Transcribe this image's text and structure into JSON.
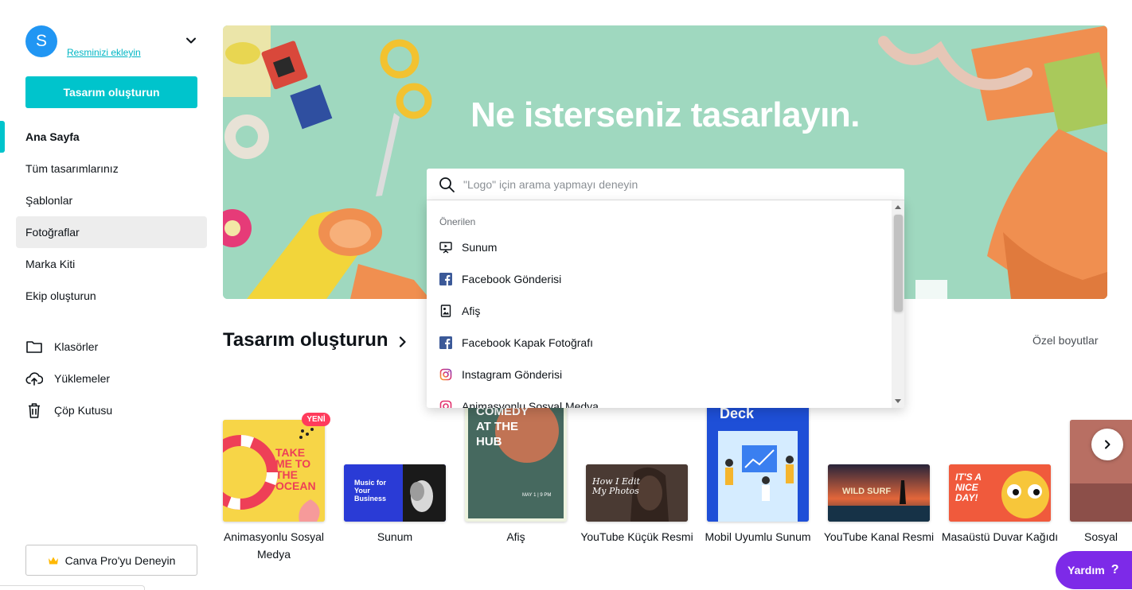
{
  "account": {
    "avatar_initial": "S",
    "add_photo_link": "Resminizi ekleyin"
  },
  "sidebar": {
    "create_button": "Tasarım oluşturun",
    "nav": [
      {
        "label": "Ana Sayfa"
      },
      {
        "label": "Tüm tasarımlarınız"
      },
      {
        "label": "Şablonlar"
      },
      {
        "label": "Fotoğraflar"
      },
      {
        "label": "Marka Kiti"
      },
      {
        "label": "Ekip oluşturun"
      }
    ],
    "secondary": [
      {
        "label": "Klasörler",
        "icon": "folder-icon"
      },
      {
        "label": "Yüklemeler",
        "icon": "cloud-upload-icon"
      },
      {
        "label": "Çöp Kutusu",
        "icon": "trash-icon"
      }
    ],
    "pro_button": "Canva Pro'yu Deneyin"
  },
  "hero": {
    "title": "Ne isterseniz tasarlayın."
  },
  "search": {
    "placeholder": "\"Logo\" için arama yapmayı deneyin",
    "dropdown_heading": "Önerilen",
    "suggestions": [
      {
        "label": "Sunum",
        "icon": "presentation-icon"
      },
      {
        "label": "Facebook Gönderisi",
        "icon": "facebook-icon"
      },
      {
        "label": "Afiş",
        "icon": "poster-icon"
      },
      {
        "label": "Facebook Kapak Fotoğrafı",
        "icon": "facebook-icon"
      },
      {
        "label": "Instagram Gönderisi",
        "icon": "instagram-icon"
      },
      {
        "label": "Animasyonlu Sosyal Medya",
        "icon": "instagram-icon"
      }
    ]
  },
  "create_section": {
    "title": "Tasarım oluşturun",
    "custom_size": "Özel boyutlar",
    "new_badge": "YENİ",
    "cards": [
      {
        "label": "Animasyonlu Sosyal Medya",
        "thumb_text": "TAKE ME TO THE OCEAN"
      },
      {
        "label": "Sunum",
        "thumb_text": "Music for Your Business"
      },
      {
        "label": "Afiş",
        "thumb_text": "COMEDY AT THE HUB",
        "thumb_sub": "MAY 1 | 9 PM"
      },
      {
        "label": "YouTube Küçük Resmi",
        "thumb_text": "How I Edit My Photos"
      },
      {
        "label": "Mobil Uyumlu Sunum",
        "thumb_text": "Deck"
      },
      {
        "label": "YouTube Kanal Resmi",
        "thumb_text": "WILD SURF"
      },
      {
        "label": "Masaüstü Duvar Kağıdı",
        "thumb_text": "IT'S A NICE DAY!"
      },
      {
        "label": "Sosyal"
      }
    ]
  },
  "help": {
    "label": "Yardım",
    "icon": "question-icon"
  },
  "colors": {
    "accent": "#00c4cc",
    "avatar": "#2196f3",
    "help": "#7d2ae8",
    "badge": "#ff3b5c"
  }
}
